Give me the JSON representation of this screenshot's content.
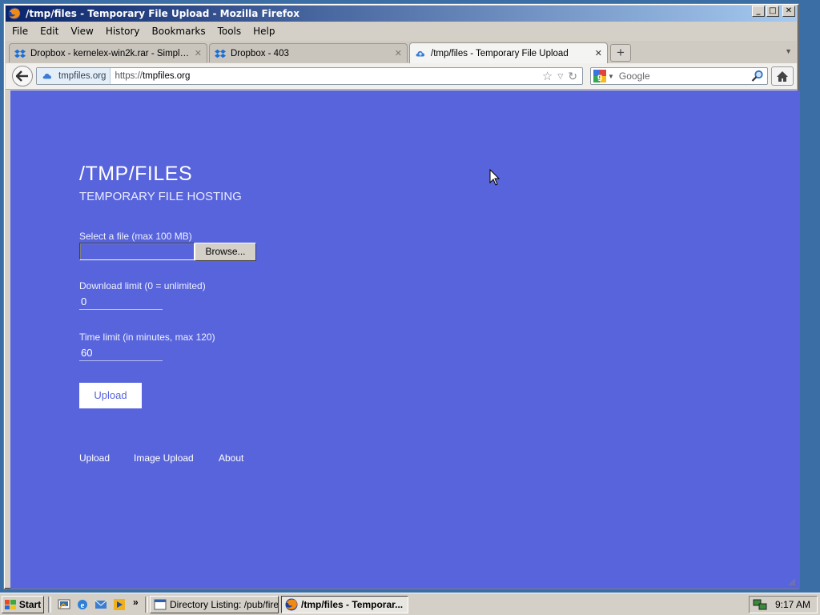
{
  "window": {
    "title": "/tmp/files - Temporary File Upload - Mozilla Firefox",
    "controls": {
      "minimize": "_",
      "maximize": "□",
      "close": "✕"
    }
  },
  "menu": [
    "File",
    "Edit",
    "View",
    "History",
    "Bookmarks",
    "Tools",
    "Help"
  ],
  "tabs": [
    {
      "label": "Dropbox - kernelex-win2k.rar - Simplify you...",
      "close": "✕",
      "icon": "dropbox-icon"
    },
    {
      "label": "Dropbox - 403",
      "close": "✕",
      "icon": "dropbox-icon"
    },
    {
      "label": "/tmp/files - Temporary File Upload",
      "close": "✕",
      "icon": "cloud-icon",
      "active": true
    }
  ],
  "new_tab": "+",
  "nav": {
    "identity": "tmpfiles.org",
    "url_scheme": "https://",
    "url_host": "tmpfiles.org",
    "search_placeholder": "Google"
  },
  "page": {
    "title": "/TMP/FILES",
    "subtitle": "TEMPORARY FILE HOSTING",
    "file_label": "Select a file (max 100 MB)",
    "browse_label": "Browse...",
    "download_label": "Download limit (0 = unlimited)",
    "download_value": "0",
    "time_label": "Time limit (in minutes, max 120)",
    "time_value": "60",
    "upload_label": "Upload",
    "footer_links": [
      "Upload",
      "Image Upload",
      "About"
    ],
    "background_color": "#5864dc"
  },
  "taskbar": {
    "start_label": "Start",
    "chevron": "»",
    "tasks": [
      {
        "label": "Directory Listing: /pub/firef...",
        "active": false
      },
      {
        "label": "/tmp/files - Temporar...",
        "active": true
      }
    ],
    "clock": "9:17 AM"
  }
}
